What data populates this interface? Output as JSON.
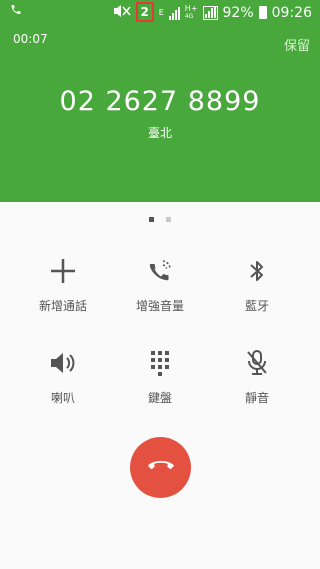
{
  "status_bar": {
    "sim_number": "2",
    "network_e": "E",
    "network_h": "H+",
    "network_h_sub": "4G",
    "battery": "92%",
    "time": "09:26",
    "icons": [
      "phone-call-icon",
      "mute-vibrate-icon",
      "sim-2-icon",
      "signal-icon",
      "battery-icon"
    ]
  },
  "call": {
    "timer": "00:07",
    "hold_label": "保留",
    "number": "02 2627 8899",
    "location": "臺北"
  },
  "actions": [
    {
      "label": "新增通話",
      "icon": "add-call-icon"
    },
    {
      "label": "增強音量",
      "icon": "volume-boost-icon"
    },
    {
      "label": "藍牙",
      "icon": "bluetooth-icon"
    },
    {
      "label": "喇叭",
      "icon": "speaker-icon"
    },
    {
      "label": "鍵盤",
      "icon": "keypad-icon"
    },
    {
      "label": "靜音",
      "icon": "mute-mic-icon"
    }
  ],
  "colors": {
    "header": "#48a83c",
    "end_call": "#e45141",
    "sim_badge": "#e53935"
  },
  "page_indicator": {
    "pages": 2,
    "active": 1
  }
}
